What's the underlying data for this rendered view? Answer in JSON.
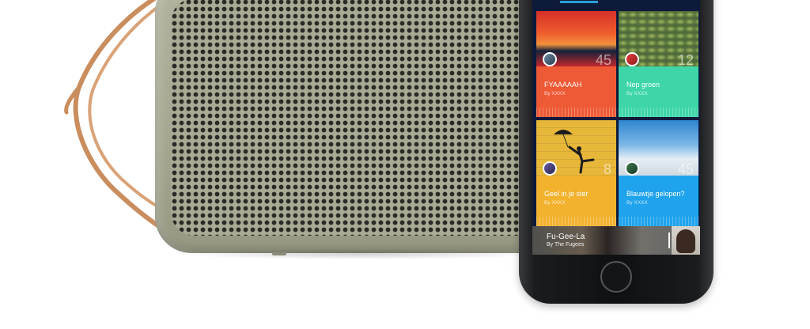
{
  "colors": {
    "speaker_body": "#a5a690",
    "strap": "#c98d5e",
    "tab_indicator": "#2a9fd8",
    "tile_1": "#ee5a35",
    "tile_2": "#3ed6a8",
    "tile_3": "#f2b22e",
    "tile_4": "#1fa3ec"
  },
  "app": {
    "tiles": [
      {
        "title": "FYAAAAAH",
        "author": "By XXXX",
        "count": "45"
      },
      {
        "title": "Nep groen",
        "author": "By XXXX",
        "count": "12"
      },
      {
        "title": "Geel in je ster",
        "author": "By XXXX",
        "count": "8"
      },
      {
        "title": "Blauwtje gelopen?",
        "author": "By XXXX",
        "count": "45"
      }
    ],
    "now_playing": {
      "title": "Fu-Gee-La",
      "artist": "By The Fugees"
    }
  }
}
